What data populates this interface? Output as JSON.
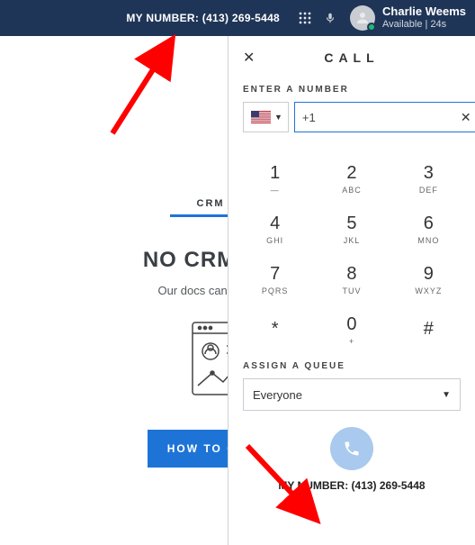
{
  "topbar": {
    "my_number_label": "MY NUMBER: (413) 269-5448",
    "user": {
      "name": "Charlie Weems",
      "status": "Available | 24s"
    }
  },
  "crm": {
    "tab_label": "CRM CONFIG",
    "heading": "NO CRM CONFIG",
    "subtext": "Our docs can help you get star",
    "button_label": "HOW TO CONFIGURE"
  },
  "call": {
    "title": "CALL",
    "close_glyph": "✕",
    "enter_label": "ENTER A NUMBER",
    "country_code_display": "🇺🇸",
    "input_value": "+1",
    "clear_glyph": "✕",
    "keys": [
      {
        "d": "1",
        "l": "—"
      },
      {
        "d": "2",
        "l": "ABC"
      },
      {
        "d": "3",
        "l": "DEF"
      },
      {
        "d": "4",
        "l": "GHI"
      },
      {
        "d": "5",
        "l": "JKL"
      },
      {
        "d": "6",
        "l": "MNO"
      },
      {
        "d": "7",
        "l": "PQRS"
      },
      {
        "d": "8",
        "l": "TUV"
      },
      {
        "d": "9",
        "l": "WXYZ"
      },
      {
        "d": "*",
        "l": ""
      },
      {
        "d": "0",
        "l": "+"
      },
      {
        "d": "#",
        "l": ""
      }
    ],
    "queue_label": "ASSIGN A QUEUE",
    "queue_value": "Everyone",
    "my_number_label": "MY NUMBER: (413) 269-5448"
  }
}
